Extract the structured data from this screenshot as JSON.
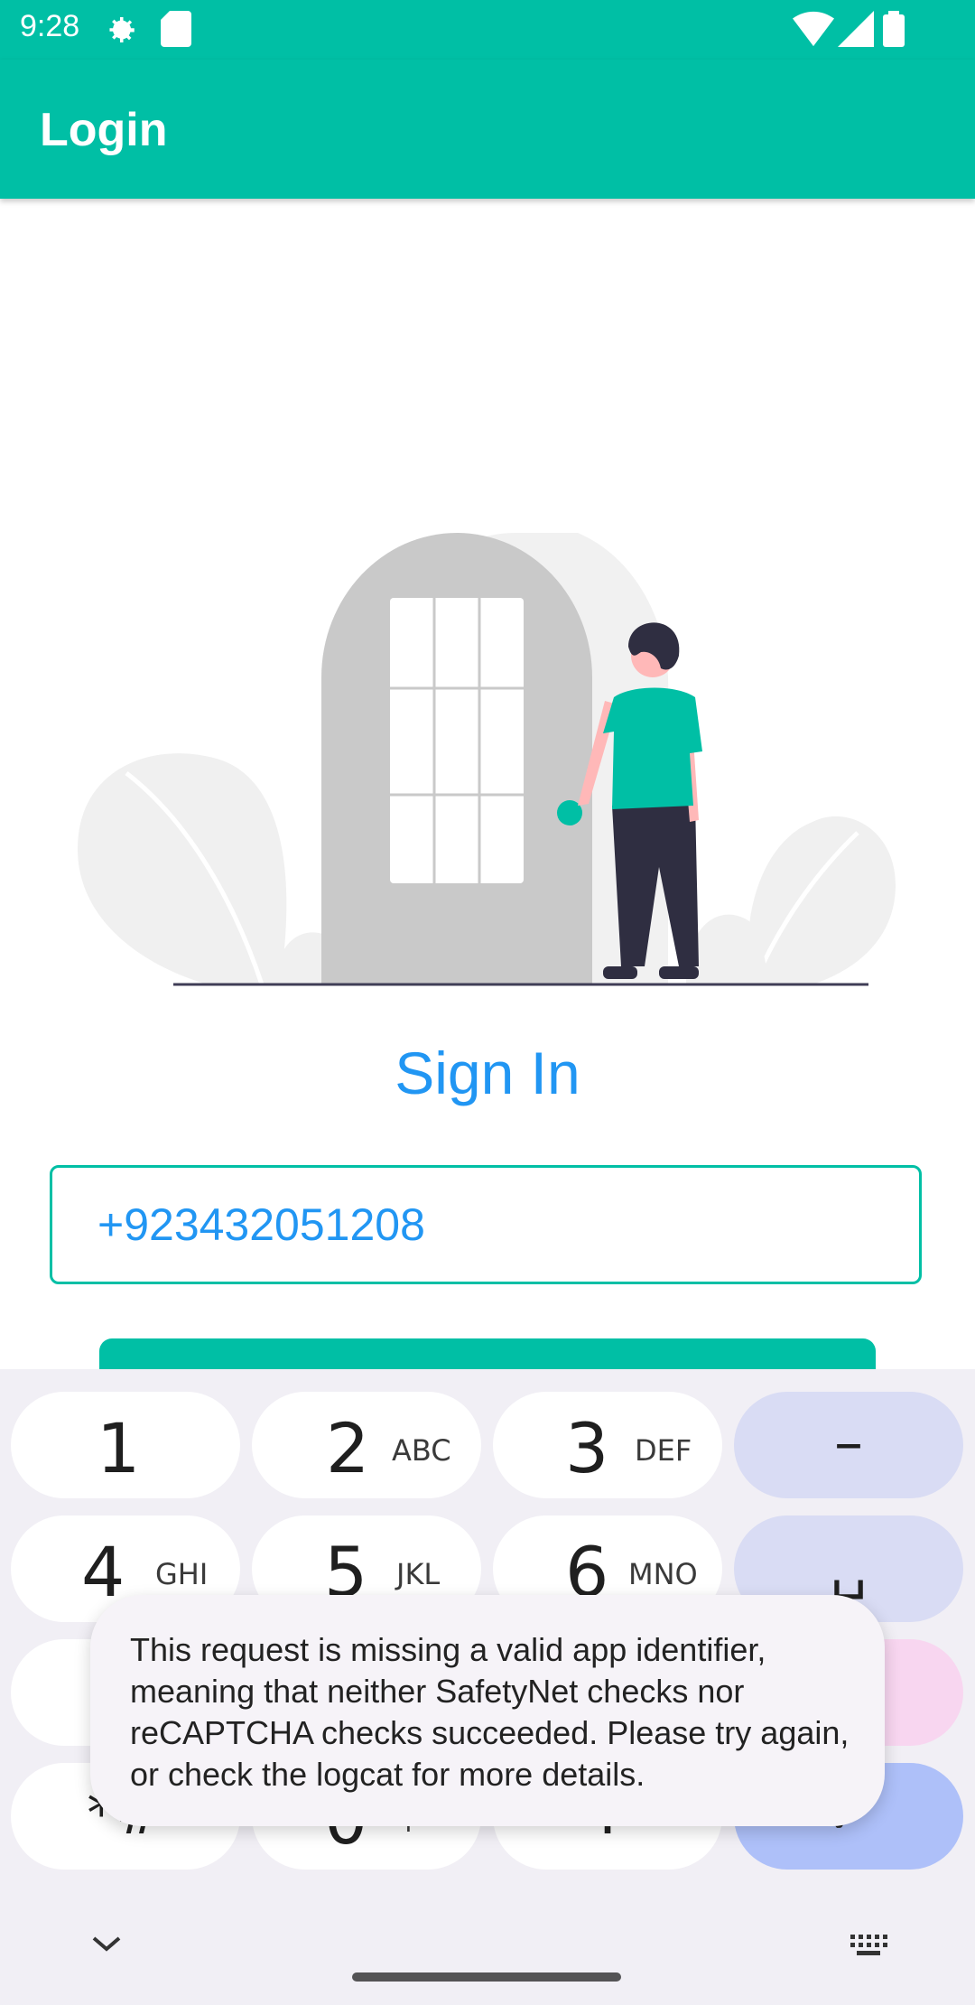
{
  "status_bar": {
    "time": "9:28",
    "left_icons": [
      "settings-icon",
      "sd-card-icon"
    ],
    "right_icons": [
      "wifi-icon",
      "signal-icon",
      "battery-icon"
    ]
  },
  "app_bar": {
    "title": "Login"
  },
  "colors": {
    "primary": "#00bfa5",
    "accent_text": "#2196f3"
  },
  "main": {
    "heading": "Sign In",
    "phone_input": {
      "value": "+923432051208"
    },
    "submit_button": {
      "label": ""
    }
  },
  "keyboard": {
    "keys": [
      {
        "num": "1",
        "letters": ""
      },
      {
        "num": "2",
        "letters": "ABC"
      },
      {
        "num": "3",
        "letters": "DEF"
      },
      {
        "sym": "–"
      },
      {
        "num": "4",
        "letters": "GHI"
      },
      {
        "num": "5",
        "letters": "JKL"
      },
      {
        "num": "6",
        "letters": "MNO"
      },
      {
        "sym": "␣"
      },
      {
        "sym": "*#"
      },
      {
        "num": "0",
        "letters": "+"
      },
      {
        "sym": "."
      },
      {
        "sym": "✓"
      }
    ]
  },
  "toast": {
    "message": "This request is missing a valid app identifier, meaning that neither SafetyNet checks nor reCAPTCHA checks succeeded. Please try again, or check the logcat for more details."
  }
}
